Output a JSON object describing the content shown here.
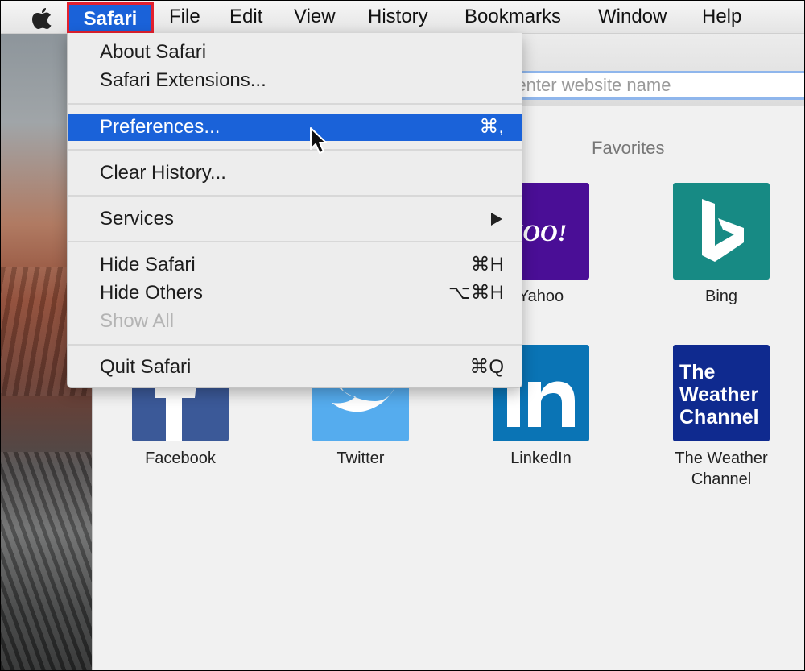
{
  "menubar": {
    "items": [
      "Safari",
      "File",
      "Edit",
      "View",
      "History",
      "Bookmarks",
      "Window",
      "Help"
    ]
  },
  "safari_menu": {
    "about": "About Safari",
    "extensions": "Safari Extensions...",
    "preferences": "Preferences...",
    "preferences_shortcut": "⌘,",
    "clear_history": "Clear History...",
    "services": "Services",
    "hide_safari": "Hide Safari",
    "hide_safari_shortcut": "⌘H",
    "hide_others": "Hide Others",
    "hide_others_shortcut": "⌥⌘H",
    "show_all": "Show All",
    "quit": "Quit Safari",
    "quit_shortcut": "⌘Q"
  },
  "address": {
    "placeholder": "r enter website name"
  },
  "favorites": {
    "heading": "Favorites",
    "items": [
      {
        "label": "Yahoo",
        "logo": "AHOO!",
        "color": "#4a0e96"
      },
      {
        "label": "Bing",
        "logo": "b",
        "color": "#178a84"
      },
      {
        "label": "Facebook",
        "logo": "f",
        "color": "#3b5998"
      },
      {
        "label": "Twitter",
        "logo": "bird",
        "color": "#55acee"
      },
      {
        "label": "LinkedIn",
        "logo": "in",
        "color": "#0a74b5"
      },
      {
        "label": "The Weather Channel",
        "logo": "The Weather Channel",
        "color": "#0f2a8f"
      }
    ]
  },
  "colors": {
    "accent": "#1a62d9",
    "highlight_border": "#e3202e"
  }
}
